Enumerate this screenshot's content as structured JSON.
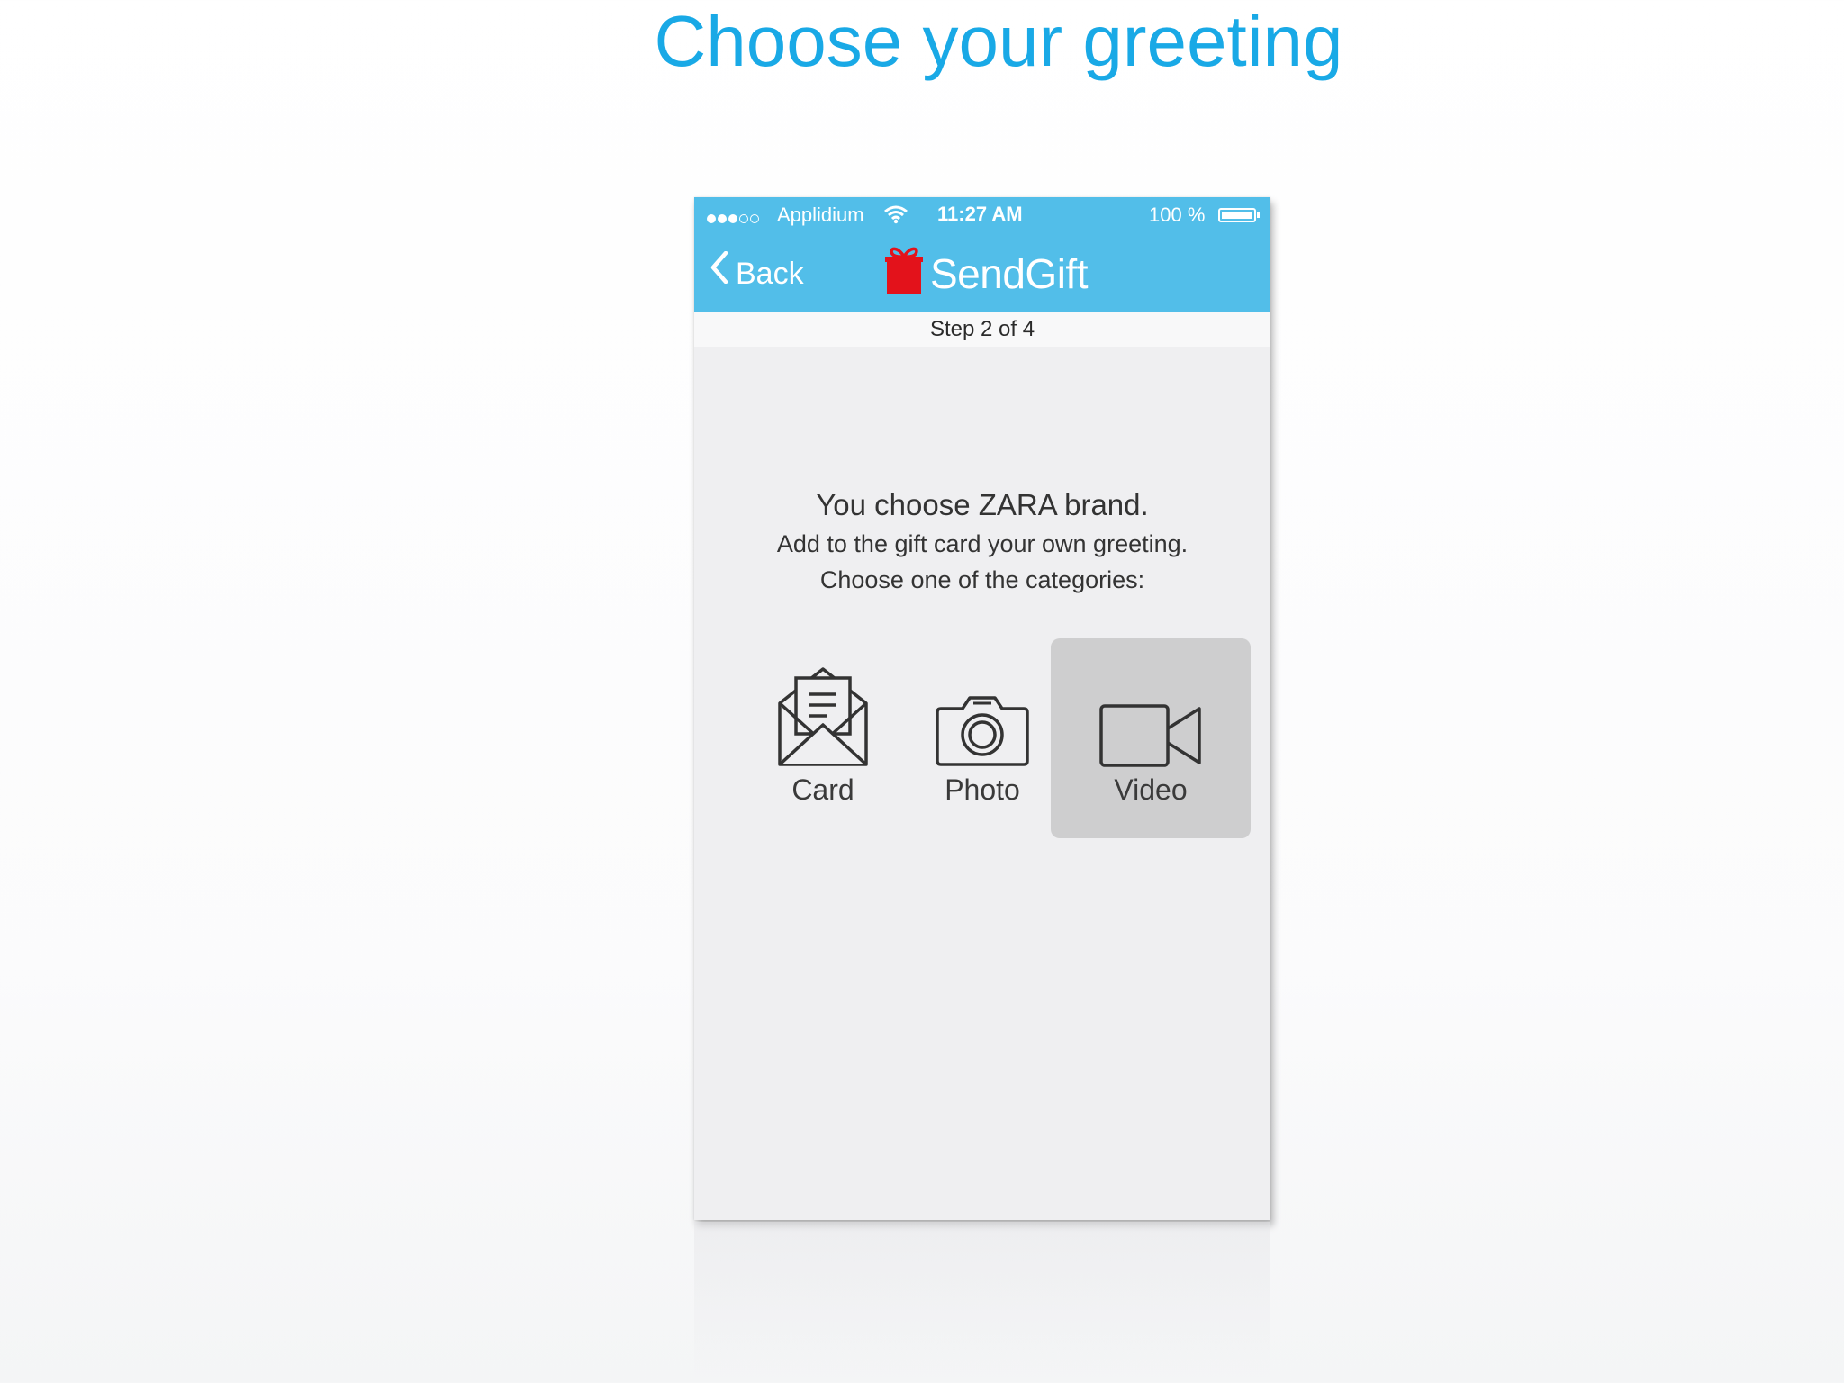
{
  "slide": {
    "title": "Choose your greeting"
  },
  "status_bar": {
    "signal_filled": 3,
    "signal_total": 5,
    "carrier": "Applidium",
    "time": "11:27 AM",
    "battery_text": "100 %",
    "battery_level": 1.0
  },
  "nav": {
    "back_label": "Back",
    "brand_name": "SendGift",
    "brand_icon": "gift-icon",
    "brand_icon_color": "#e3121b"
  },
  "step": {
    "text": "Step 2 of 4"
  },
  "message": {
    "title": "You choose ZARA brand.",
    "line1": "Add to the gift card your own greeting.",
    "line2": "Choose one of the categories:"
  },
  "options": [
    {
      "label": "Card",
      "icon": "envelope-letter-icon",
      "selected": false
    },
    {
      "label": "Photo",
      "icon": "camera-icon",
      "selected": false
    },
    {
      "label": "Video",
      "icon": "video-camera-icon",
      "selected": true
    }
  ],
  "colors": {
    "title": "#19a9e6",
    "nav_bar": "#52bee9",
    "screen_bg": "#efeff1",
    "selected_option": "#cececf"
  }
}
